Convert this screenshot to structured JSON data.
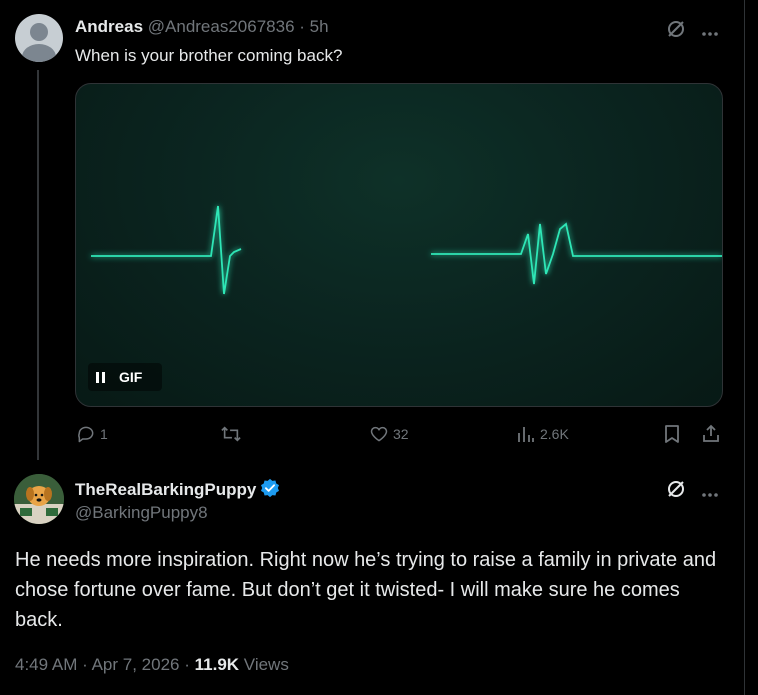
{
  "reply": {
    "name": "Andreas",
    "handle": "@Andreas2067836",
    "separator": "·",
    "time": "5h",
    "text": "When is your brother coming back?",
    "media_badge": "GIF",
    "media_icon": "pause-icon",
    "actions": {
      "replies": "1",
      "reposts": "",
      "likes": "32",
      "views": "2.6K"
    }
  },
  "main": {
    "name": "TheRealBarkingPuppy",
    "verified": true,
    "handle": "@BarkingPuppy8",
    "text": "He needs more inspiration. Right now he’s trying to raise a family in private and chose fortune over fame. But don’t get it twisted- I will make sure he comes back.",
    "time": "4:49 AM",
    "dot1": "·",
    "date": "Apr 7, 2026",
    "dot2": "·",
    "views": "11.9K",
    "views_label": "Views"
  },
  "colors": {
    "background": "#000000",
    "text": "#e7e9ea",
    "muted": "#71767b",
    "verified": "#1d9bf0",
    "wave": "#2ee6b6"
  }
}
